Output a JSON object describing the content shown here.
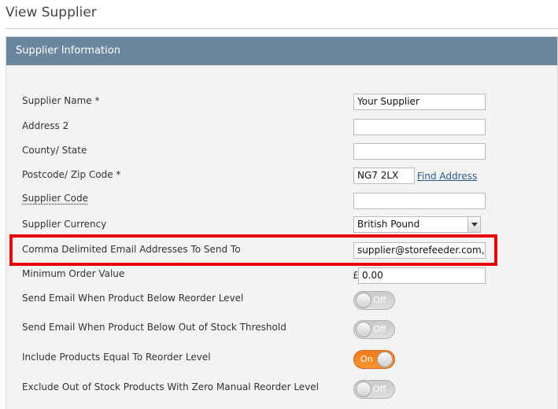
{
  "page": {
    "title": "View Supplier"
  },
  "panel": {
    "header": "Supplier Information"
  },
  "fields": {
    "supplier_name": {
      "label": "Supplier Name *",
      "value": "Your Supplier"
    },
    "address2": {
      "label": "Address 2",
      "value": ""
    },
    "county": {
      "label": "County/ State",
      "value": ""
    },
    "postcode": {
      "label": "Postcode/ Zip Code *",
      "value": "NG7 2LX",
      "link": "Find Address"
    },
    "supplier_code": {
      "label": "Supplier Code",
      "value": ""
    },
    "currency": {
      "label": "Supplier Currency",
      "value": "British Pound"
    },
    "emails": {
      "label": "Comma Delimited Email Addresses To Send To",
      "value": "supplier@storefeeder.com, upp"
    },
    "min_order": {
      "label": "Minimum Order Value",
      "symbol": "£",
      "value": "0.00"
    }
  },
  "toggles": [
    {
      "label": "Send Email When Product Below Reorder Level",
      "state": "Off"
    },
    {
      "label": "Send Email When Product Below Out of Stock Threshold",
      "state": "Off"
    },
    {
      "label": "Include Products Equal To Reorder Level",
      "state": "On"
    },
    {
      "label": "Exclude Out of Stock Products With Zero Manual Reorder Level",
      "state": "Off"
    }
  ],
  "colors": {
    "header": "#6d86a0",
    "toggle_on": "#f07a1a",
    "highlight": "#e60000"
  }
}
